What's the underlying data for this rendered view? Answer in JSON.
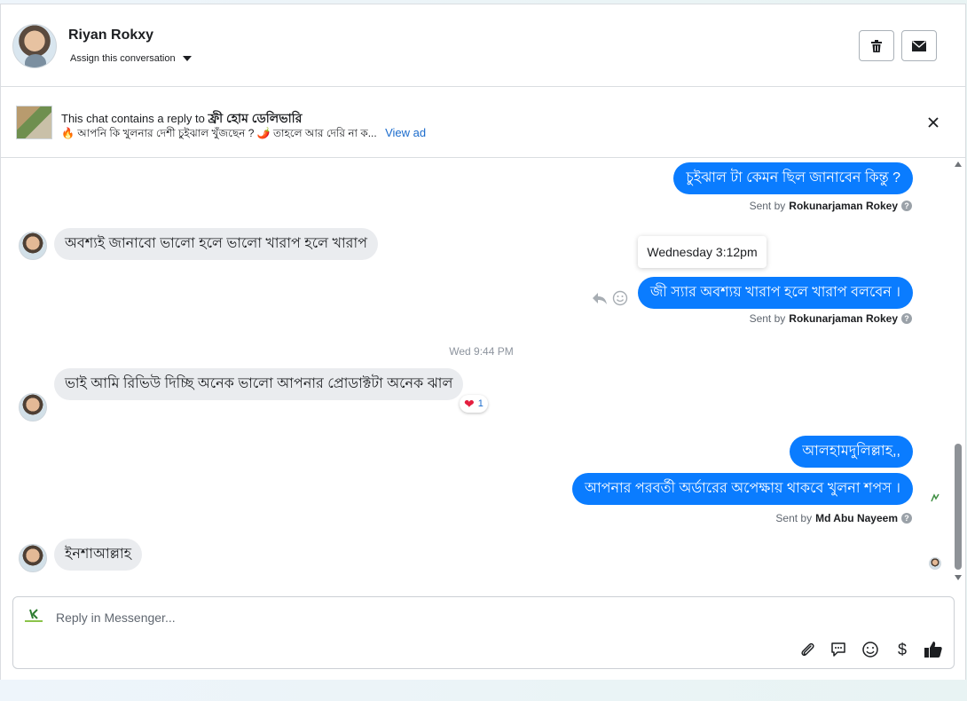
{
  "header": {
    "contact_name": "Riyan Rokxy",
    "assign_label": "Assign this conversation"
  },
  "ad_bar": {
    "title_prefix": "This chat contains a reply to",
    "ad_name": "ফ্রী হোম ডেলিভারি",
    "preview": "🔥 আপনি কি খুলনার দেশী চুইঝাল খুঁজছেন ? 🌶️ তাহলে আর দেরি না ক...",
    "view_ad_label": "View ad"
  },
  "messages": {
    "m1_text": "চুইঝাল টা কেমন ছিল জানাবেন কিন্তু ?",
    "m1_sent_prefix": "Sent by",
    "m1_sender": "Rokunarjaman Rokey",
    "m2_text": "অবশ্যই জানাবো ভালো হলে ভালো খারাপ হলে খারাপ",
    "tooltip": "Wednesday 3:12pm",
    "m3_text": "জী স্যার অবশ্যয় খারাপ হলে খারাপ বলবেন ।",
    "m3_sent_prefix": "Sent by",
    "m3_sender": "Rokunarjaman Rokey",
    "time_separator": "Wed 9:44 PM",
    "m4_text": "ভাই আমি রিভিউ দিচ্ছি অনেক ভালো আপনার প্রোডাক্টটা অনেক ঝাল",
    "m4_reaction_count": "1",
    "m5_text": "আলহামদুলিল্লাহ,,",
    "m6_text": "আপনার পরবর্তী অর্ডারের অপেক্ষায় থাকবে খুলনা শপস ।",
    "m6_sent_prefix": "Sent by",
    "m6_sender": "Md Abu Nayeem",
    "m7_text": "ইনশাআল্লাহ"
  },
  "composer": {
    "placeholder": "Reply in Messenger..."
  },
  "colors": {
    "outgoing_bubble": "#0a7cff",
    "incoming_bubble": "#eaecef",
    "link": "#1a6bcc"
  }
}
